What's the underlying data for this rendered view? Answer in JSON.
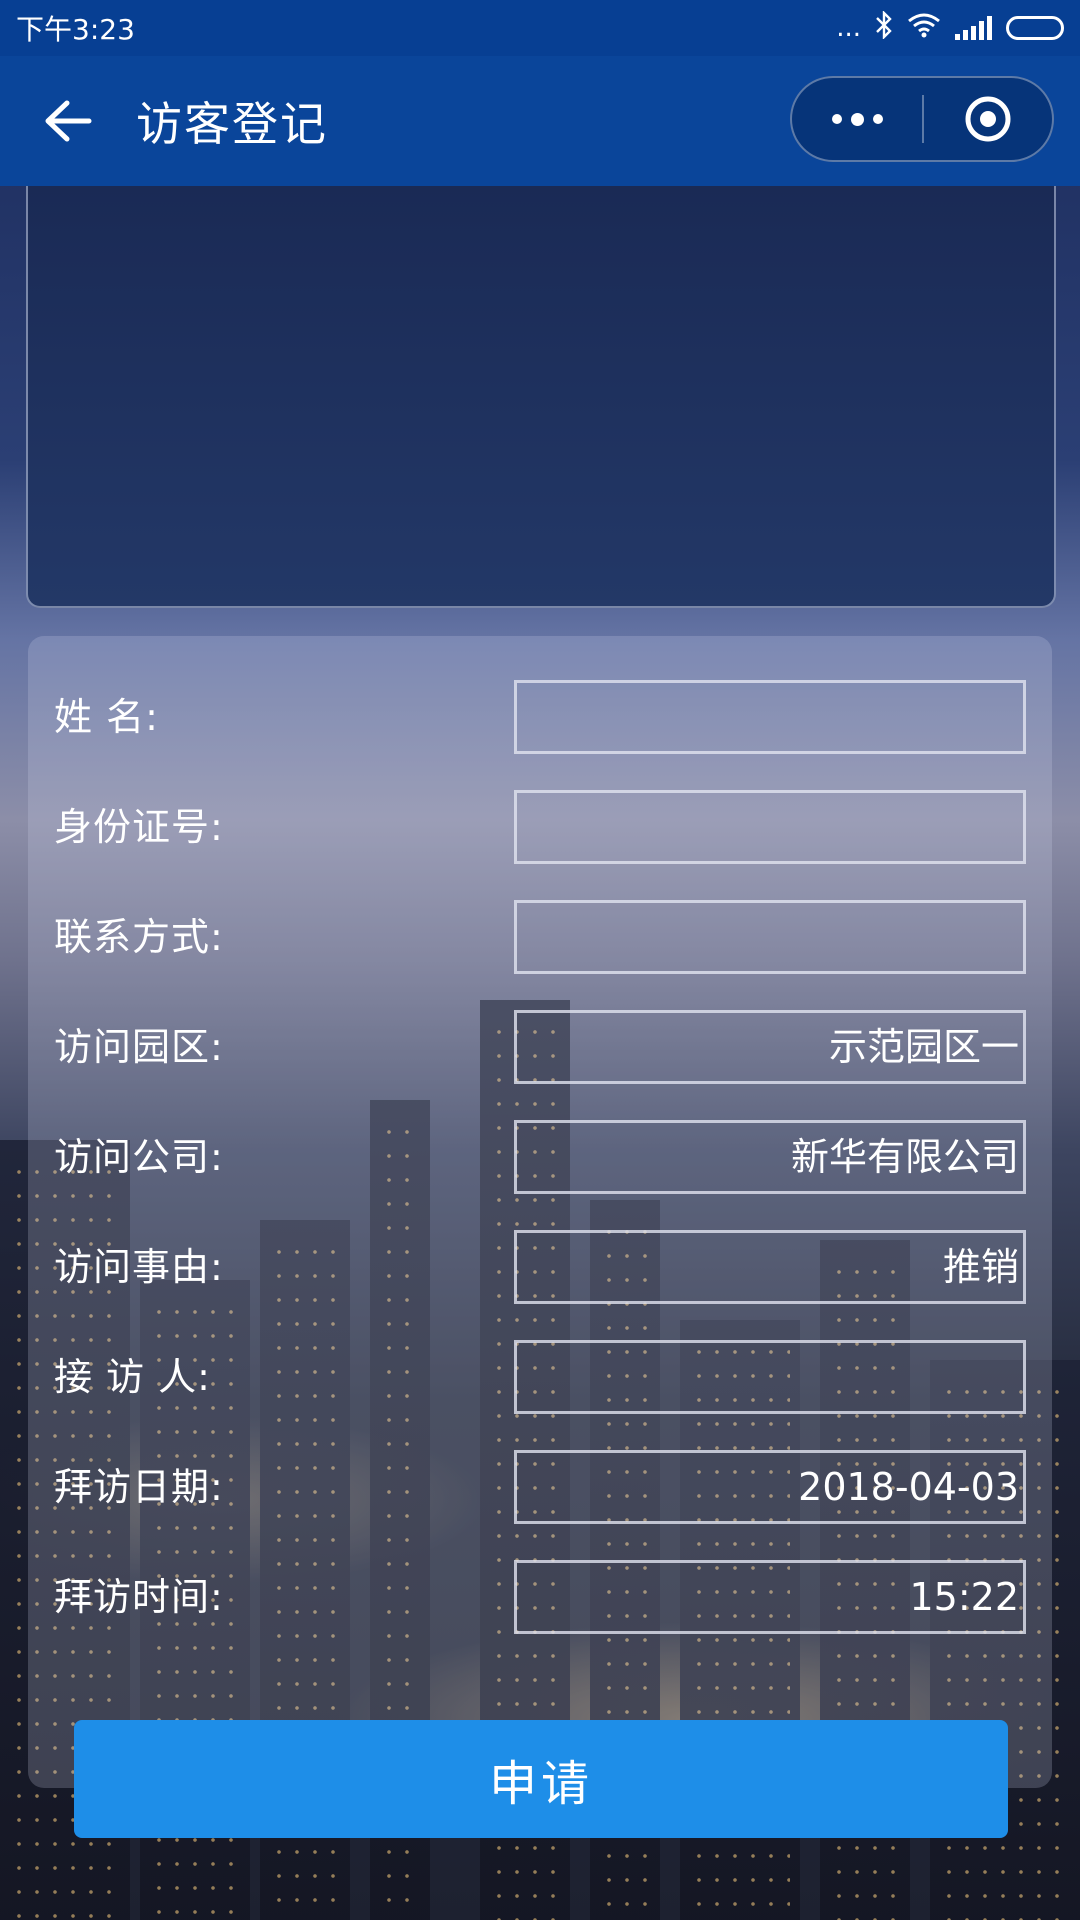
{
  "status_bar": {
    "time": "下午3:23",
    "dots": "...",
    "bluetooth": "bluetooth-icon",
    "wifi": "wifi-icon"
  },
  "nav": {
    "title": "访客登记",
    "back_icon": "back-arrow-icon",
    "more_icon": "more-dots-icon",
    "close_icon": "record-circle-icon"
  },
  "form": {
    "fields": [
      {
        "label": "姓 名:",
        "value": ""
      },
      {
        "label": "身份证号:",
        "value": ""
      },
      {
        "label": "联系方式:",
        "value": ""
      },
      {
        "label": "访问园区:",
        "value": "示范园区一"
      },
      {
        "label": "访问公司:",
        "value": "新华有限公司"
      },
      {
        "label": "访问事由:",
        "value": "推销"
      },
      {
        "label": "接 访 人:",
        "value": ""
      },
      {
        "label": "拜访日期:",
        "value": "2018-04-03"
      },
      {
        "label": "拜访时间:",
        "value": "15:22"
      }
    ]
  },
  "submit": {
    "label": "申请"
  },
  "colors": {
    "nav_bar": "#0a459a",
    "status_bar": "#073f93",
    "button": "#1e8ee8"
  }
}
